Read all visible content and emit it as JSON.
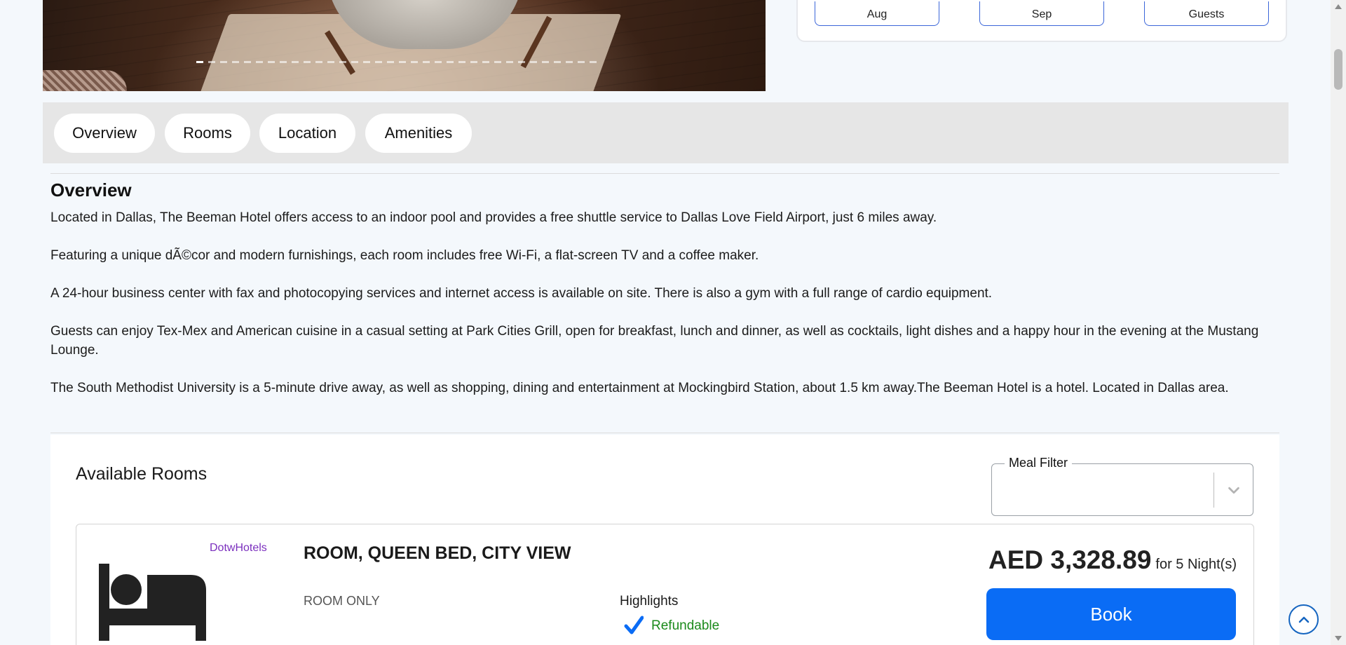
{
  "booking": {
    "checkin_label": "Aug",
    "checkout_label": "Sep",
    "guests_label": "Guests"
  },
  "gallery": {
    "slide_count": 34,
    "active_index": 0
  },
  "tabs": [
    {
      "label": "Overview"
    },
    {
      "label": "Rooms"
    },
    {
      "label": "Location"
    },
    {
      "label": "Amenities"
    }
  ],
  "overview": {
    "title": "Overview",
    "paragraphs": [
      "Located in Dallas, The Beeman Hotel offers access to an indoor pool and provides a free shuttle service to Dallas Love Field Airport, just 6 miles away.",
      "Featuring a unique dÃ©cor and modern furnishings, each room includes free Wi-Fi, a flat-screen TV and a coffee maker.",
      "A 24-hour business center with fax and photocopying services and internet access is available on site. There is also a gym with a full range of cardio equipment.",
      "Guests can enjoy Tex-Mex and American cuisine in a casual setting at Park Cities Grill, open for breakfast, lunch and dinner, as well as cocktails, light dishes and a happy hour in the evening at the Mustang Lounge.",
      "The South Methodist University is a 5-minute drive away, as well as shopping, dining and entertainment at Mockingbird Station, about 1.5 km away.The Beeman Hotel is a hotel. Located in Dallas area."
    ]
  },
  "rooms": {
    "title": "Available Rooms",
    "meal_filter_label": "Meal Filter",
    "meal_filter_value": "",
    "items": [
      {
        "supplier": "DotwHotels",
        "name": "ROOM, QUEEN BED, CITY VIEW",
        "board": "ROOM ONLY",
        "highlights_label": "Highlights",
        "highlight": "Refundable",
        "price": "AED 3,328.89",
        "nights": "for 5 Night(s)",
        "book_label": "Book"
      }
    ]
  },
  "colors": {
    "accent": "#0a6cf5",
    "supplier": "#7b2fbe",
    "refundable": "#1b8a1b"
  },
  "icons": {
    "room": "bed-icon",
    "highlight": "check-icon",
    "filter": "chevron-down-icon",
    "scroll_top": "chevron-up-icon"
  }
}
